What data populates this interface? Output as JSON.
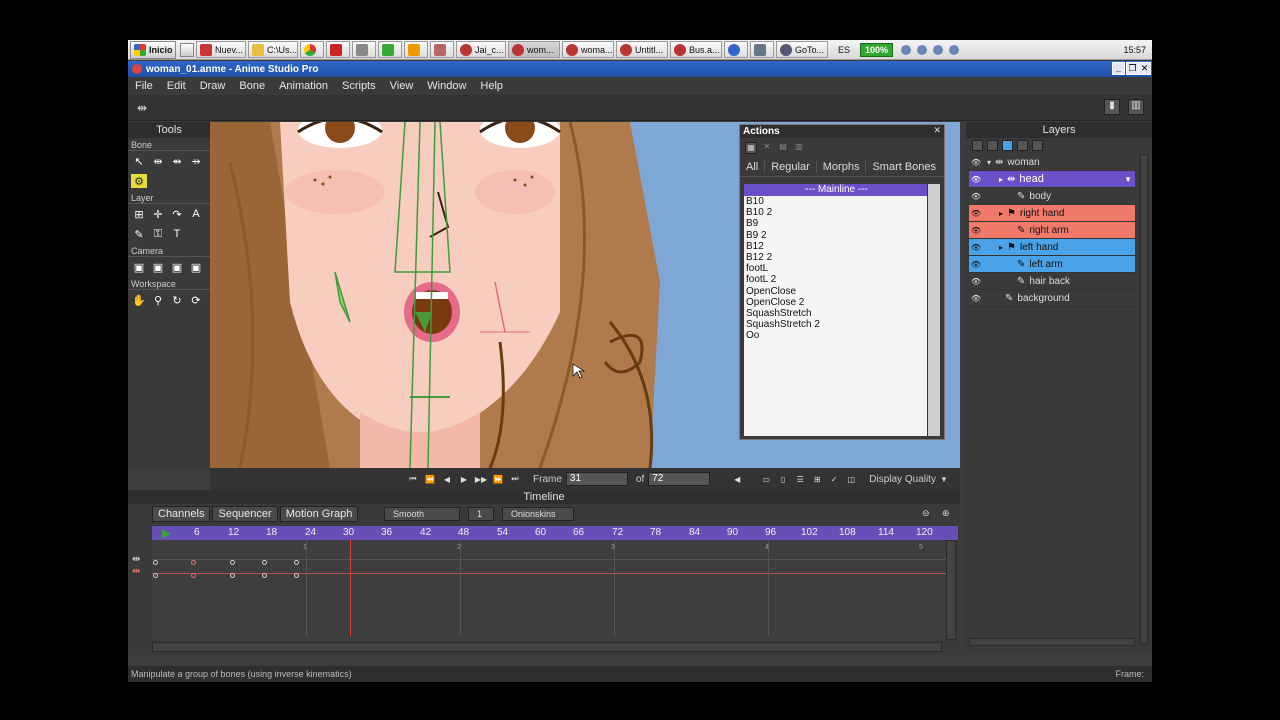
{
  "taskbar": {
    "start_label": "Inicio",
    "buttons": [
      "Nuev...",
      "C:\\Us...",
      "",
      "",
      "",
      "",
      "",
      "Jai_c...",
      "wom...",
      "woma...",
      "Untitl...",
      "Bus.a...",
      "",
      "",
      "GoTo..."
    ],
    "language": "ES",
    "battery": "100%",
    "clock": "15:57"
  },
  "window": {
    "title": "woman_01.anme - Anime Studio Pro"
  },
  "menu": [
    "File",
    "Edit",
    "Draw",
    "Bone",
    "Animation",
    "Scripts",
    "View",
    "Window",
    "Help"
  ],
  "tools": {
    "title": "Tools",
    "sections": [
      "Bone",
      "Layer",
      "Camera",
      "Workspace"
    ]
  },
  "actions": {
    "title": "Actions",
    "tabs": [
      "All",
      "Regular",
      "Morphs",
      "Smart Bones"
    ],
    "mainline": "--- Mainline ---",
    "items": [
      "B10",
      "B10 2",
      "B9",
      "B9 2",
      "B12",
      "B12 2",
      "footL",
      "footL 2",
      "OpenClose",
      "OpenClose 2",
      "SquashStretch",
      "SquashStretch 2",
      "Oo"
    ]
  },
  "layers": {
    "title": "Layers",
    "rows": [
      {
        "name": "woman",
        "style": ""
      },
      {
        "name": "head",
        "style": "sel-purple"
      },
      {
        "name": "body",
        "style": ""
      },
      {
        "name": "right hand",
        "style": "sel-red"
      },
      {
        "name": "right arm",
        "style": "sel-red"
      },
      {
        "name": "left hand",
        "style": "sel-blue"
      },
      {
        "name": "left arm",
        "style": "sel-blue"
      },
      {
        "name": "hair back",
        "style": ""
      },
      {
        "name": "background",
        "style": ""
      }
    ]
  },
  "canvas_footer": {
    "frame_label": "Frame",
    "frame_value": "31",
    "of_label": "of",
    "total_frames": "72",
    "display_quality": "Display Quality"
  },
  "timeline": {
    "title": "Timeline",
    "tabs": [
      "Channels",
      "Sequencer",
      "Motion Graph"
    ],
    "interp": "Smooth",
    "interval": "1",
    "onionskins": "Onionskins",
    "ruler": [
      "6",
      "12",
      "18",
      "24",
      "30",
      "36",
      "42",
      "48",
      "54",
      "60",
      "66",
      "72",
      "78",
      "84",
      "90",
      "96",
      "102",
      "108",
      "114",
      "120"
    ],
    "markers": [
      "1",
      "2",
      "3",
      "4",
      "5"
    ]
  },
  "status": {
    "message": "Manipulate a group of bones (using inverse kinematics)",
    "frame_label": "Frame:"
  }
}
